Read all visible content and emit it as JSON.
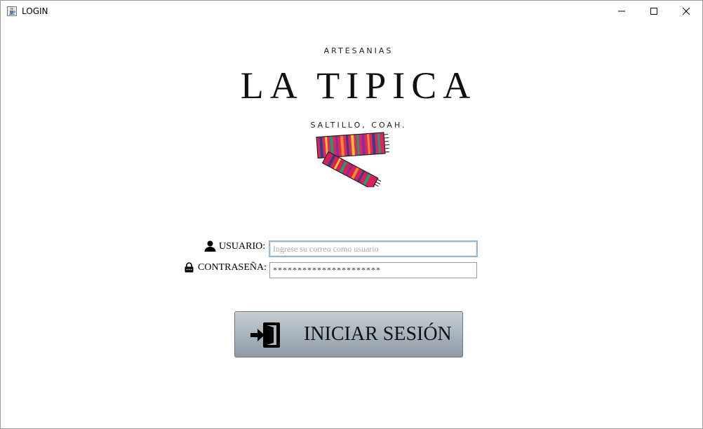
{
  "window": {
    "title": "LOGIN",
    "icons": {
      "app": "java-cup-icon",
      "minimize": "minimize-icon",
      "maximize": "maximize-icon",
      "close": "close-icon"
    }
  },
  "logo": {
    "top_text": "ARTESANIAS",
    "title": "LA TIPICA",
    "subtitle": "SALTILLO, COAH.",
    "art": "striped-scarf-icon"
  },
  "form": {
    "user_label": "USUARIO:",
    "user_icon": "user-icon",
    "user_placeholder": "Ingrese su correo como usuario",
    "password_label": "CONTRASEÑA:",
    "password_icon": "lock-icon",
    "password_value": "**********************"
  },
  "login_button": {
    "label": "INICIAR SESIÓN",
    "icon": "sign-in-icon"
  }
}
